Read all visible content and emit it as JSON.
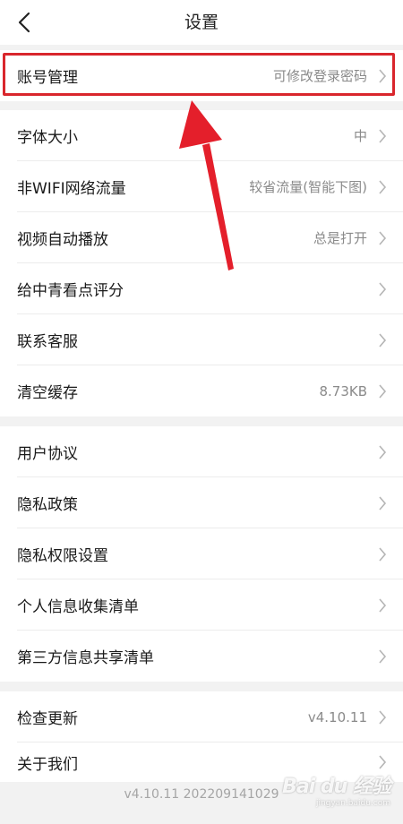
{
  "nav": {
    "title": "设置",
    "back_icon": "chevron-left-icon"
  },
  "groups": [
    {
      "items": [
        {
          "label": "账号管理",
          "value": "可修改登录密码"
        }
      ]
    },
    {
      "items": [
        {
          "label": "字体大小",
          "value": "中"
        },
        {
          "label": "非WIFI网络流量",
          "value": "较省流量(智能下图)"
        },
        {
          "label": "视频自动播放",
          "value": "总是打开"
        },
        {
          "label": "给中青看点评分",
          "value": ""
        },
        {
          "label": "联系客服",
          "value": ""
        },
        {
          "label": "清空缓存",
          "value": "8.73KB"
        }
      ]
    },
    {
      "items": [
        {
          "label": "用户协议",
          "value": ""
        },
        {
          "label": "隐私政策",
          "value": ""
        },
        {
          "label": "隐私权限设置",
          "value": ""
        },
        {
          "label": "个人信息收集清单",
          "value": ""
        },
        {
          "label": "第三方信息共享清单",
          "value": ""
        }
      ]
    },
    {
      "items": [
        {
          "label": "检查更新",
          "value": "v4.10.11"
        },
        {
          "label": "关于我们",
          "value": ""
        }
      ]
    }
  ],
  "footer": {
    "version": "v4.10.11 202209141029"
  },
  "watermark": {
    "text": "Bai du 经验",
    "sub": "jingyan.baidu.com"
  },
  "colors": {
    "highlight": "#d9262c",
    "arrow": "#e41f2b",
    "value_text": "#8a8a8a",
    "background": "#f2f2f2"
  }
}
